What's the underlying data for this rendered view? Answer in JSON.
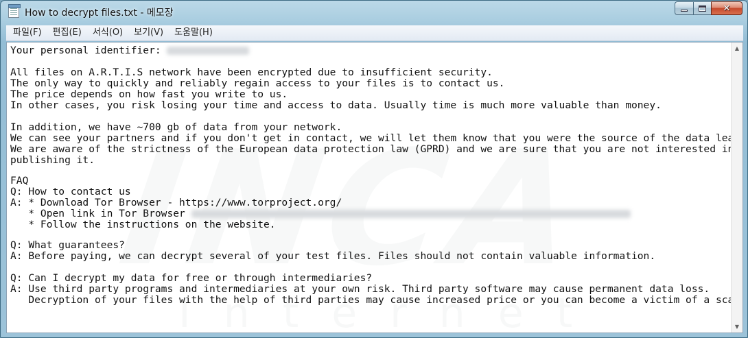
{
  "window": {
    "title": "How to decrypt files.txt - 메모장",
    "caption": {
      "minimize": "",
      "maximize": "",
      "close": "✕"
    }
  },
  "menu": {
    "items": [
      "파일(F)",
      "편집(E)",
      "서식(O)",
      "보기(V)",
      "도움말(H)"
    ]
  },
  "document": {
    "lines": [
      "Your personal identifier: ",
      "",
      "All files on A.R.T.I.S network have been encrypted due to insufficient security.",
      "The only way to quickly and reliably regain access to your files is to contact us.",
      "The price depends on how fast you write to us.",
      "In other cases, you risk losing your time and access to data. Usually time is much more valuable than money.",
      "",
      "In addition, we have ~700 gb of data from your network.",
      "We can see your partners and if you don't get in contact, we will let them know that you were the source of the data leak.",
      "We are aware of the strictness of the European data protection law (GPRD) and we are sure that you are not interested in",
      "publishing it.",
      "",
      "FAQ",
      "Q: How to contact us",
      "A: * Download Tor Browser - https://www.torproject.org/",
      "   * Open link in Tor Browser ",
      "   * Follow the instructions on the website.",
      "",
      "Q: What guarantees?",
      "A: Before paying, we can decrypt several of your test files. Files should not contain valuable information.",
      "",
      "Q: Can I decrypt my data for free or through intermediaries?",
      "A: Use third party programs and intermediaries at your own risk. Third party software may cause permanent data loss.",
      "   Decryption of your files with the help of third parties may cause increased price or you can become a victim of a scam."
    ]
  },
  "watermark": {
    "main": "INCA",
    "sub": "Internet"
  },
  "scrollbar": {
    "up_arrow": "▲",
    "down_arrow": "▼"
  }
}
